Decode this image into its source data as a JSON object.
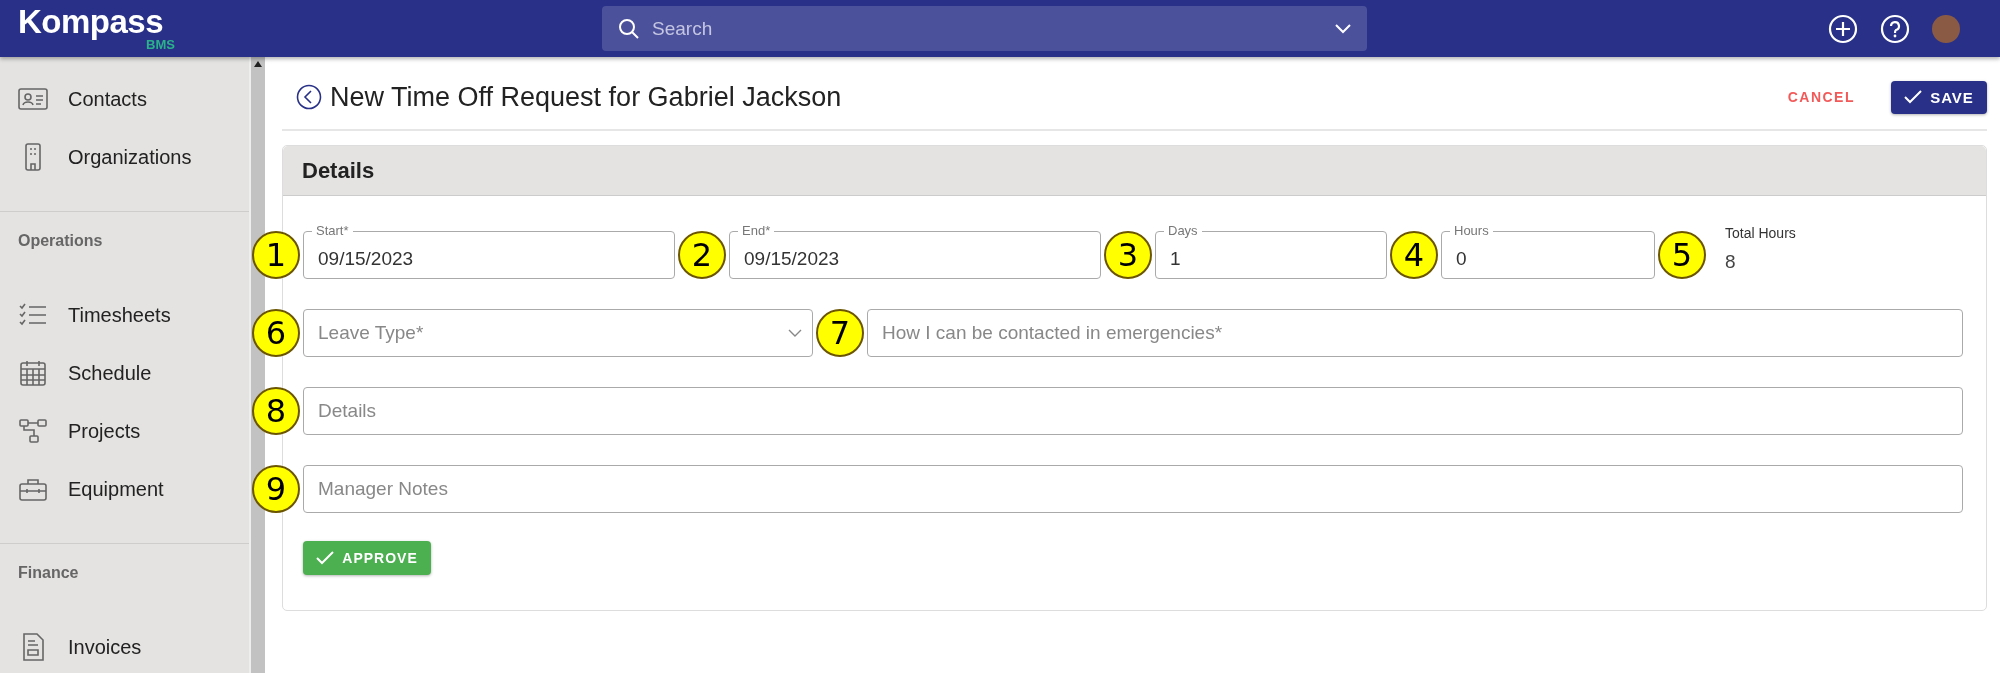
{
  "header": {
    "logo": {
      "name": "Kompass",
      "sub": "BMS"
    },
    "search": {
      "placeholder": "Search"
    }
  },
  "sidebar": {
    "sections": [
      {
        "items": [
          {
            "label": "Contacts",
            "kind": "contacts"
          },
          {
            "label": "Organizations",
            "kind": "building"
          }
        ]
      },
      {
        "title": "Operations",
        "items": [
          {
            "label": "Timesheets",
            "kind": "checklist"
          },
          {
            "label": "Schedule",
            "kind": "calendar"
          },
          {
            "label": "Projects",
            "kind": "nodes"
          },
          {
            "label": "Equipment",
            "kind": "toolbox"
          }
        ]
      },
      {
        "title": "Finance",
        "items": [
          {
            "label": "Invoices",
            "kind": "invoice"
          }
        ]
      }
    ]
  },
  "page": {
    "title": "New Time Off Request for Gabriel Jackson",
    "cancel": "CANCEL",
    "save": "SAVE"
  },
  "card": {
    "title": "Details",
    "date_row": [
      {
        "kind": "field",
        "label": "Start*",
        "value": "09/15/2023",
        "callout": "1"
      },
      {
        "kind": "field",
        "label": "End*",
        "value": "09/15/2023",
        "callout": "2"
      },
      {
        "kind": "field",
        "label": "Days",
        "value": "1",
        "callout": "3"
      },
      {
        "kind": "field",
        "label": "Hours",
        "value": "0",
        "callout": "4"
      },
      {
        "kind": "display",
        "label": "Total Hours",
        "value": "8",
        "callout": "5"
      }
    ],
    "select_row": [
      {
        "kind": "select",
        "placeholder": "Leave Type*",
        "callout": "6"
      },
      {
        "kind": "text",
        "placeholder": "How I can be contacted in emergencies*",
        "callout": "7"
      }
    ],
    "text_fields": [
      {
        "placeholder": "Details",
        "callout": "8"
      },
      {
        "placeholder": "Manager Notes",
        "callout": "9"
      }
    ],
    "approve": "APPROVE"
  }
}
